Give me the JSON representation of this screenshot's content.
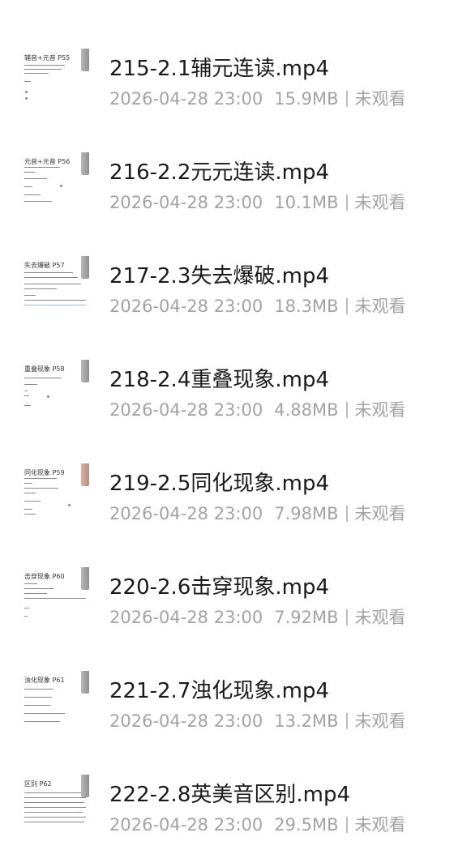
{
  "files": [
    {
      "name": "215-2.1辅元连读.mp4",
      "date": "2026-04-28 23:00",
      "size": "15.9MB",
      "status": "未观看",
      "thumb_heading": "辅音+元音 P55"
    },
    {
      "name": "216-2.2元元连读.mp4",
      "date": "2026-04-28 23:00",
      "size": "10.1MB",
      "status": "未观看",
      "thumb_heading": "元音+元音 P56"
    },
    {
      "name": "217-2.3失去爆破.mp4",
      "date": "2026-04-28 23:00",
      "size": "18.3MB",
      "status": "未观看",
      "thumb_heading": "失去爆破 P57"
    },
    {
      "name": "218-2.4重叠现象.mp4",
      "date": "2026-04-28 23:00",
      "size": "4.88MB",
      "status": "未观看",
      "thumb_heading": "重叠现象 P58"
    },
    {
      "name": "219-2.5同化现象.mp4",
      "date": "2026-04-28 23:00",
      "size": "7.98MB",
      "status": "未观看",
      "thumb_heading": "同化现象 P59"
    },
    {
      "name": "220-2.6击穿现象.mp4",
      "date": "2026-04-28 23:00",
      "size": "7.92MB",
      "status": "未观看",
      "thumb_heading": "击穿现象 P60"
    },
    {
      "name": "221-2.7浊化现象.mp4",
      "date": "2026-04-28 23:00",
      "size": "13.2MB",
      "status": "未观看",
      "thumb_heading": "浊化现象 P61"
    },
    {
      "name": "222-2.8英美音区别.mp4",
      "date": "2026-04-28 23:00",
      "size": "29.5MB",
      "status": "未观看",
      "thumb_heading": "区别 P62"
    }
  ]
}
